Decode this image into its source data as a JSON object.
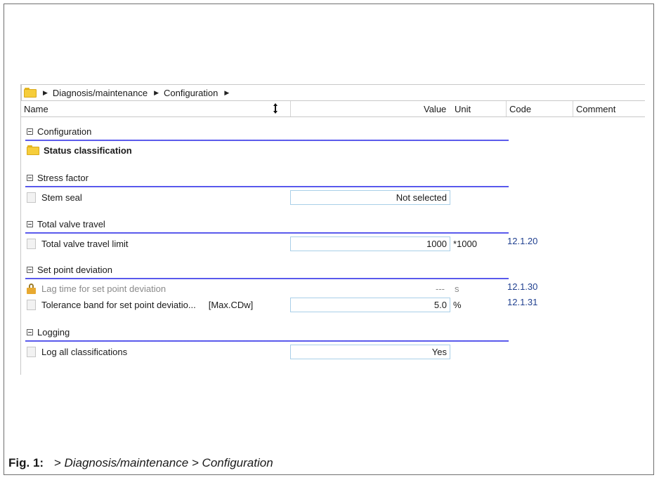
{
  "breadcrumb": {
    "items": [
      "Diagnosis/maintenance",
      "Configuration"
    ]
  },
  "columns": {
    "name": "Name",
    "value": "Value",
    "unit": "Unit",
    "code": "Code",
    "comment": "Comment"
  },
  "tree": {
    "configuration_group": "Configuration",
    "status_classification": "Status classification",
    "stress_factor_group": "Stress factor",
    "stem_seal": {
      "label": "Stem seal",
      "value": "Not selected"
    },
    "total_valve_travel_group": "Total valve travel",
    "total_valve_travel_limit": {
      "label": "Total valve travel limit",
      "value": "1000",
      "unit": "*1000",
      "code": "12.1.20"
    },
    "set_point_deviation_group": "Set point deviation",
    "lag_time": {
      "label": "Lag time for set point deviation",
      "value": "---",
      "unit": "s",
      "code": "12.1.30"
    },
    "tolerance_band": {
      "label": "Tolerance band for set point deviatio...",
      "suffix": "[Max.CDw]",
      "value": "5.0",
      "unit": "%",
      "code": "12.1.31"
    },
    "logging_group": "Logging",
    "log_all": {
      "label": "Log all classifications",
      "value": "Yes"
    }
  },
  "caption": {
    "label": "Fig. 1:",
    "path": "> Diagnosis/maintenance > Configuration"
  }
}
